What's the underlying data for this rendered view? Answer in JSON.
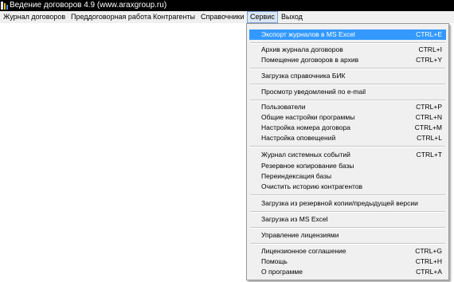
{
  "window": {
    "title": "Ведение договоров 4.9 (www.araxgroup.ru)",
    "app_icon": "app-icon"
  },
  "menubar": {
    "items": [
      {
        "label": "Журнал договоров"
      },
      {
        "label": "Преддоговорная работа"
      },
      {
        "label": "Контрагенты"
      },
      {
        "label": "Справочники"
      },
      {
        "label": "Сервис"
      },
      {
        "label": "Выход"
      }
    ],
    "active": "Сервис"
  },
  "dropdown": {
    "items": [
      {
        "label": "Экспорт журналов в MS Excel",
        "shortcut": "CTRL+E"
      },
      {
        "label": "Архив журнала договоров",
        "shortcut": "CTRL+I"
      },
      {
        "label": "Помещение договоров в архив",
        "shortcut": "CTRL+Y"
      },
      {
        "label": "Загрузка справочника БИК",
        "shortcut": ""
      },
      {
        "label": "Просмотр уведомлений по e-mail",
        "shortcut": ""
      },
      {
        "label": "Пользователи",
        "shortcut": "CTRL+P"
      },
      {
        "label": "Общие настройки программы",
        "shortcut": "CTRL+N"
      },
      {
        "label": "Настройка номера договора",
        "shortcut": "CTRL+M"
      },
      {
        "label": "Настройка оповещений",
        "shortcut": "CTRL+L"
      },
      {
        "label": "Журнал системных событий",
        "shortcut": "CTRL+T"
      },
      {
        "label": "Резервное копирование базы",
        "shortcut": ""
      },
      {
        "label": "Переиндексация базы",
        "shortcut": ""
      },
      {
        "label": "Очистить историю контрагентов",
        "shortcut": ""
      },
      {
        "label": "Загрузка из резервной копии/предыдущей версии",
        "shortcut": ""
      },
      {
        "label": "Загрузка из MS Excel",
        "shortcut": ""
      },
      {
        "label": "Управление лицензиями",
        "shortcut": ""
      },
      {
        "label": "Лицензионное соглашение",
        "shortcut": "CTRL+G"
      },
      {
        "label": "Помощь",
        "shortcut": "CTRL+H"
      },
      {
        "label": "О программе",
        "shortcut": "CTRL+A"
      }
    ],
    "selected": "Экспорт журналов в MS Excel"
  },
  "colors": {
    "titlebar_bg": "#000000",
    "menubar_bg": "#f0f0f0",
    "highlight": "#3399ff"
  }
}
